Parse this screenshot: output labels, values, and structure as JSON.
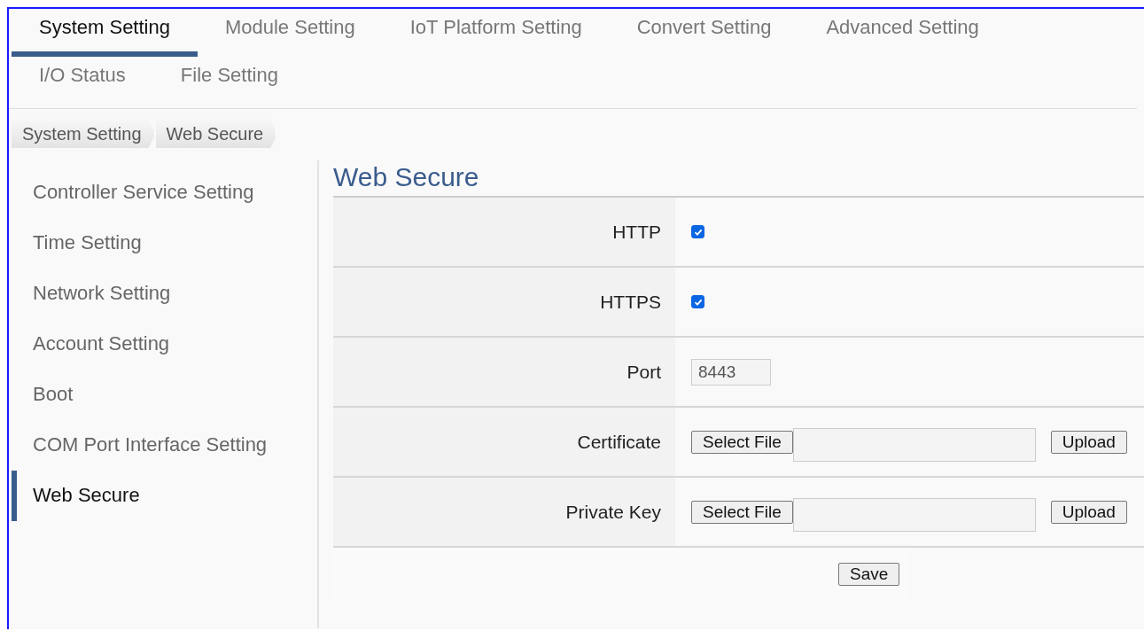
{
  "tabs": [
    {
      "label": "System Setting",
      "selected": true
    },
    {
      "label": "Module Setting",
      "selected": false
    },
    {
      "label": "IoT Platform Setting",
      "selected": false
    },
    {
      "label": "Convert Setting",
      "selected": false
    },
    {
      "label": "Advanced Setting",
      "selected": false
    },
    {
      "label": "I/O Status",
      "selected": false
    },
    {
      "label": "File Setting",
      "selected": false
    }
  ],
  "breadcrumb": [
    "System Setting",
    "Web Secure"
  ],
  "sidebar": {
    "items": [
      {
        "label": "Controller Service Setting",
        "selected": false
      },
      {
        "label": "Time Setting",
        "selected": false
      },
      {
        "label": "Network Setting",
        "selected": false
      },
      {
        "label": "Account Setting",
        "selected": false
      },
      {
        "label": "Boot",
        "selected": false
      },
      {
        "label": "COM Port Interface Setting",
        "selected": false
      },
      {
        "label": "Web Secure",
        "selected": true
      }
    ]
  },
  "content": {
    "title": "Web Secure",
    "rows": [
      {
        "kind": "checkbox",
        "label": "HTTP",
        "checked": true
      },
      {
        "kind": "checkbox",
        "label": "HTTPS",
        "checked": true
      },
      {
        "kind": "text",
        "label": "Port",
        "value": "8443"
      },
      {
        "kind": "file",
        "label": "Certificate",
        "select_button": "Select File",
        "upload_button": "Upload"
      },
      {
        "kind": "file",
        "label": "Private Key",
        "select_button": "Select File",
        "upload_button": "Upload"
      }
    ],
    "save_button": "Save"
  }
}
